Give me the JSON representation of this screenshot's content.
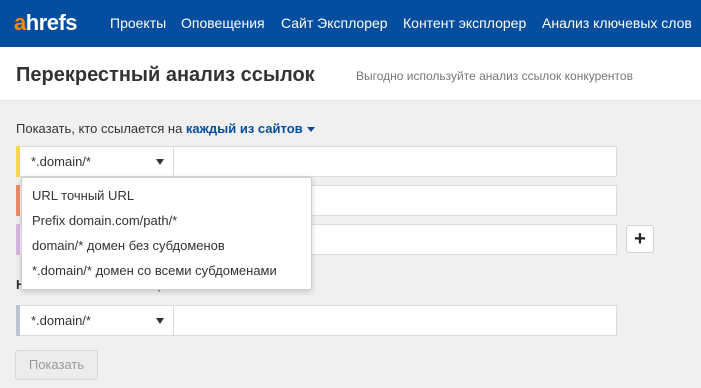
{
  "brand": {
    "logo_accent": "a",
    "logo_rest": "hrefs"
  },
  "nav": {
    "items": [
      "Проекты",
      "Оповещения",
      "Сайт Эксплорер",
      "Контент эксплорер",
      "Анализ ключевых слов"
    ]
  },
  "header": {
    "title": "Перекрестный анализ ссылок",
    "subtitle": "Выгодно используйте анализ ссылок конкурентов"
  },
  "form": {
    "show_prefix": "Показать, кто ссылается на",
    "show_link": "каждый из сайтов",
    "rows": [
      {
        "mode": "*.domain/*",
        "value": "",
        "color": "#f7d84a"
      },
      {
        "mode": "",
        "value": "",
        "color": "#f08c6a"
      },
      {
        "mode": "",
        "value": "",
        "color": "#d6b8e2"
      }
    ],
    "exclude_label": "Н",
    "exclude_paren": "(",
    "exclude_row": {
      "mode": "*.domain/*",
      "value": "",
      "color": "#b9c6d2"
    },
    "submit_label": "Показать",
    "plus_label": "+"
  },
  "dropdown": {
    "options": [
      "URL точный URL",
      "Prefix domain.com/path/*",
      "domain/* домен без субдоменов",
      "*.domain/* домен со всеми субдоменами"
    ]
  },
  "colors": {
    "nav_bg": "#054d9e",
    "logo_accent": "#ff8800",
    "link": "#054d9e"
  }
}
